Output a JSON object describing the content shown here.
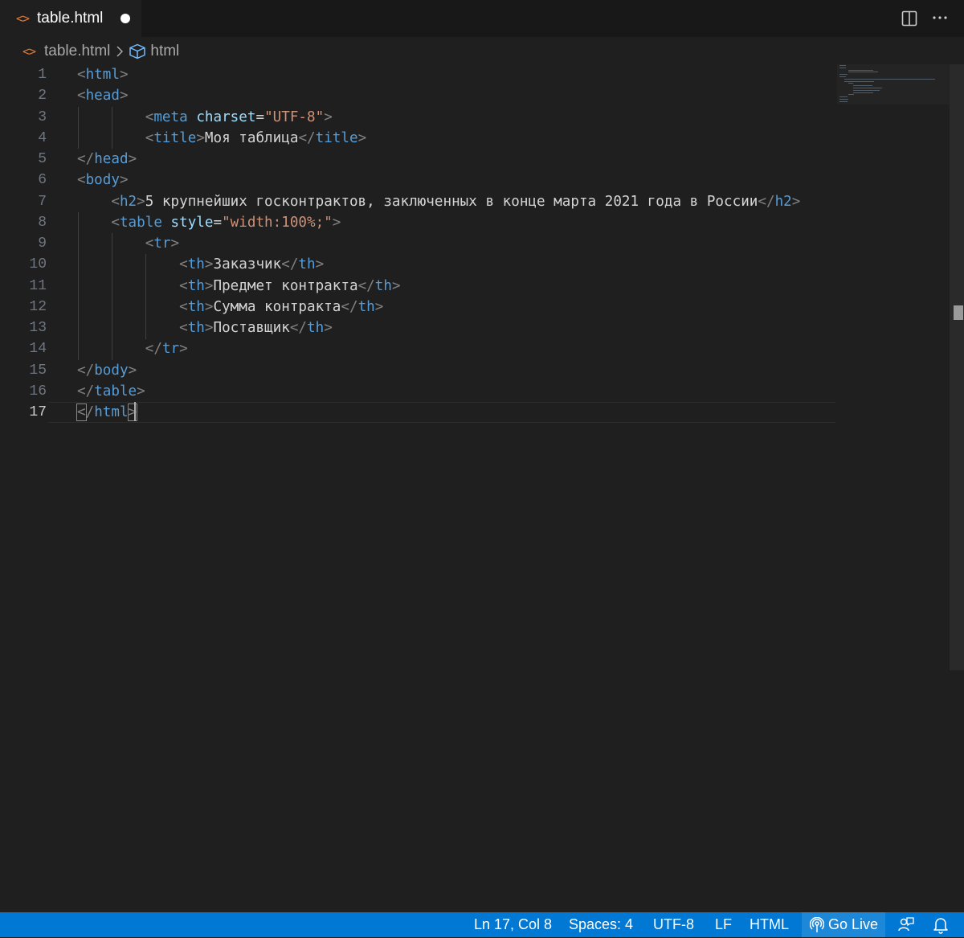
{
  "tab": {
    "filename": "table.html",
    "file_icon": "html-file-icon",
    "modified": true
  },
  "breadcrumb": {
    "file": "table.html",
    "symbol": "html",
    "separator_icon": "chevron-right-icon",
    "symbol_icon": "cube-icon"
  },
  "editor": {
    "active_line": 17,
    "lines": [
      {
        "n": "1",
        "tokens": [
          [
            "punc",
            "<"
          ],
          [
            "tag",
            "html"
          ],
          [
            "punc",
            ">"
          ]
        ]
      },
      {
        "n": "2",
        "tokens": [
          [
            "punc",
            "<"
          ],
          [
            "tag",
            "head"
          ],
          [
            "punc",
            ">"
          ]
        ]
      },
      {
        "n": "3",
        "tokens": [
          [
            "txt",
            "        "
          ],
          [
            "punc",
            "<"
          ],
          [
            "tag",
            "meta"
          ],
          [
            "txt",
            " "
          ],
          [
            "attr",
            "charset"
          ],
          [
            "txt",
            "="
          ],
          [
            "str",
            "\"UTF-8\""
          ],
          [
            "punc",
            ">"
          ]
        ]
      },
      {
        "n": "4",
        "tokens": [
          [
            "txt",
            "        "
          ],
          [
            "punc",
            "<"
          ],
          [
            "tag",
            "title"
          ],
          [
            "punc",
            ">"
          ],
          [
            "txt",
            "Моя таблица"
          ],
          [
            "punc",
            "</"
          ],
          [
            "tag",
            "title"
          ],
          [
            "punc",
            ">"
          ]
        ]
      },
      {
        "n": "5",
        "tokens": [
          [
            "punc",
            "</"
          ],
          [
            "tag",
            "head"
          ],
          [
            "punc",
            ">"
          ]
        ]
      },
      {
        "n": "6",
        "tokens": [
          [
            "punc",
            "<"
          ],
          [
            "tag",
            "body"
          ],
          [
            "punc",
            ">"
          ]
        ]
      },
      {
        "n": "7",
        "tokens": [
          [
            "txt",
            "    "
          ],
          [
            "punc",
            "<"
          ],
          [
            "tag",
            "h2"
          ],
          [
            "punc",
            ">"
          ],
          [
            "txt",
            "5 крупнейших госконтрактов, заключенных в конце марта 2021 года в России"
          ],
          [
            "punc",
            "</"
          ],
          [
            "tag",
            "h2"
          ],
          [
            "punc",
            ">"
          ]
        ]
      },
      {
        "n": "8",
        "tokens": [
          [
            "txt",
            "    "
          ],
          [
            "punc",
            "<"
          ],
          [
            "tag",
            "table"
          ],
          [
            "txt",
            " "
          ],
          [
            "attr",
            "style"
          ],
          [
            "txt",
            "="
          ],
          [
            "str",
            "\"width:100%;\""
          ],
          [
            "punc",
            ">"
          ]
        ]
      },
      {
        "n": "9",
        "tokens": [
          [
            "txt",
            "        "
          ],
          [
            "punc",
            "<"
          ],
          [
            "tag",
            "tr"
          ],
          [
            "punc",
            ">"
          ]
        ]
      },
      {
        "n": "10",
        "tokens": [
          [
            "txt",
            "            "
          ],
          [
            "punc",
            "<"
          ],
          [
            "tag",
            "th"
          ],
          [
            "punc",
            ">"
          ],
          [
            "txt",
            "Заказчик"
          ],
          [
            "punc",
            "</"
          ],
          [
            "tag",
            "th"
          ],
          [
            "punc",
            ">"
          ]
        ]
      },
      {
        "n": "11",
        "tokens": [
          [
            "txt",
            "            "
          ],
          [
            "punc",
            "<"
          ],
          [
            "tag",
            "th"
          ],
          [
            "punc",
            ">"
          ],
          [
            "txt",
            "Предмет контракта"
          ],
          [
            "punc",
            "</"
          ],
          [
            "tag",
            "th"
          ],
          [
            "punc",
            ">"
          ]
        ]
      },
      {
        "n": "12",
        "tokens": [
          [
            "txt",
            "            "
          ],
          [
            "punc",
            "<"
          ],
          [
            "tag",
            "th"
          ],
          [
            "punc",
            ">"
          ],
          [
            "txt",
            "Сумма контракта"
          ],
          [
            "punc",
            "</"
          ],
          [
            "tag",
            "th"
          ],
          [
            "punc",
            ">"
          ]
        ]
      },
      {
        "n": "13",
        "tokens": [
          [
            "txt",
            "            "
          ],
          [
            "punc",
            "<"
          ],
          [
            "tag",
            "th"
          ],
          [
            "punc",
            ">"
          ],
          [
            "txt",
            "Поставщик"
          ],
          [
            "punc",
            "</"
          ],
          [
            "tag",
            "th"
          ],
          [
            "punc",
            ">"
          ]
        ]
      },
      {
        "n": "14",
        "tokens": [
          [
            "txt",
            "        "
          ],
          [
            "punc",
            "</"
          ],
          [
            "tag",
            "tr"
          ],
          [
            "punc",
            ">"
          ]
        ]
      },
      {
        "n": "15",
        "tokens": [
          [
            "punc",
            "</"
          ],
          [
            "tag",
            "body"
          ],
          [
            "punc",
            ">"
          ]
        ]
      },
      {
        "n": "16",
        "tokens": [
          [
            "punc",
            "</"
          ],
          [
            "tag",
            "table"
          ],
          [
            "punc",
            ">"
          ]
        ]
      },
      {
        "n": "17",
        "tokens": [
          [
            "bm",
            "<"
          ],
          [
            "punc",
            "/"
          ],
          [
            "tag",
            "html"
          ],
          [
            "bm",
            ">"
          ]
        ]
      }
    ]
  },
  "statusbar": {
    "position": "Ln 17, Col 8",
    "indent": "Spaces: 4",
    "encoding": "UTF-8",
    "eol": "LF",
    "language": "HTML",
    "go_live": "Go Live"
  },
  "colors": {
    "statusbar": "#0078d4",
    "editor_bg": "#1f1f1f",
    "tag": "#569cd6",
    "attr": "#9cdcfe",
    "string": "#ce9178",
    "file_icon": "#e37933"
  }
}
